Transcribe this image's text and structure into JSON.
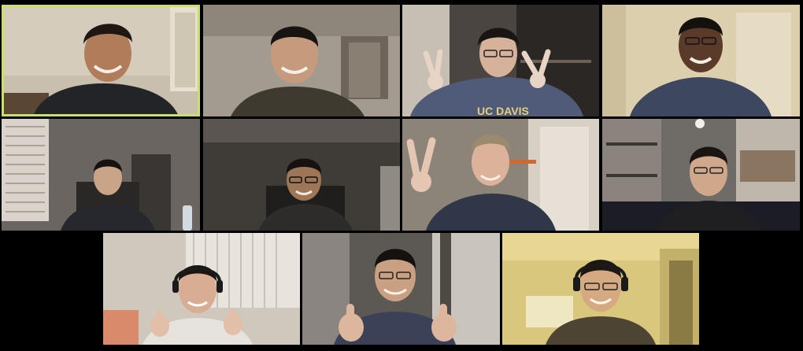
{
  "gallery": {
    "active_speaker_color": "#c9e06a",
    "background_color": "#000000",
    "tiles": [
      {
        "shirt_text": ""
      },
      {
        "shirt_text": ""
      },
      {
        "shirt_text": "UC DAVIS"
      },
      {
        "shirt_text": ""
      },
      {
        "shirt_text": ""
      },
      {
        "shirt_text": ""
      },
      {
        "shirt_text": ""
      },
      {
        "shirt_text": ""
      },
      {
        "shirt_text": ""
      },
      {
        "shirt_text": ""
      },
      {
        "shirt_text": ""
      }
    ]
  }
}
